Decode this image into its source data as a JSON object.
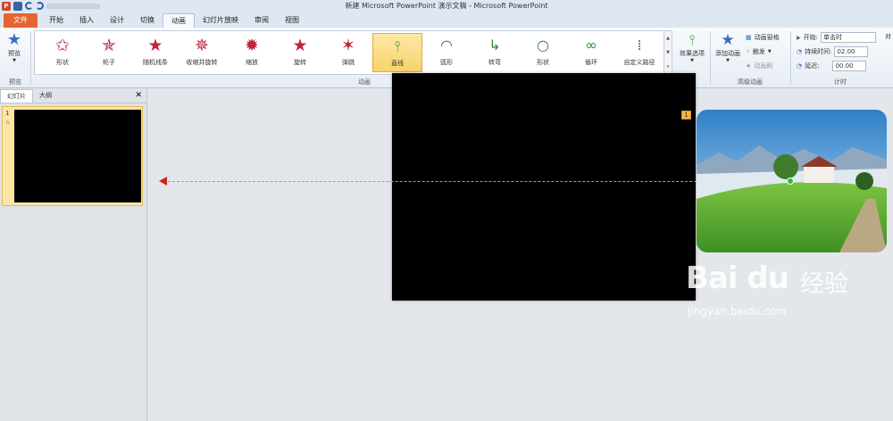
{
  "window": {
    "title": "新建 Microsoft PowerPoint 演示文稿 - Microsoft PowerPoint"
  },
  "tabs": [
    "文件",
    "开始",
    "插入",
    "设计",
    "切换",
    "动画",
    "幻灯片放映",
    "审阅",
    "视图"
  ],
  "ribbon": {
    "preview_label": "预览",
    "preview_group": "预览",
    "animations": [
      "形状",
      "轮子",
      "随机线条",
      "收缩并旋转",
      "缩放",
      "旋转",
      "弹跳",
      "直线",
      "弧形",
      "转弯",
      "形状",
      "循环",
      "自定义路径"
    ],
    "animations_group": "动画",
    "effect_options": "效果选项",
    "add_animation": "添加动画",
    "animation_pane": "动画窗格",
    "trigger": "触发",
    "animation_painter": "动画刷",
    "advanced_group": "高级动画",
    "start_label": "开始:",
    "start_value": "单击时",
    "duration_label": "持续时间:",
    "duration_value": "02.00",
    "delay_label": "延迟:",
    "delay_value": "00.00",
    "timing_group": "计时",
    "reorder_label": "对"
  },
  "left_pane": {
    "tab_slides": "幻灯片",
    "tab_outline": "大纲",
    "slide_number": "1",
    "slide_mark": "☆"
  },
  "slide": {
    "animation_badge": "1"
  },
  "watermark": {
    "logo": "Bai du",
    "cn": "经验",
    "url": "jingyan.baidu.com"
  },
  "colors": {
    "file_tab": "#e5642f",
    "selected_anim": "#f8d36b",
    "path_end": "#d0201c",
    "path_start": "#2bbf2b"
  }
}
